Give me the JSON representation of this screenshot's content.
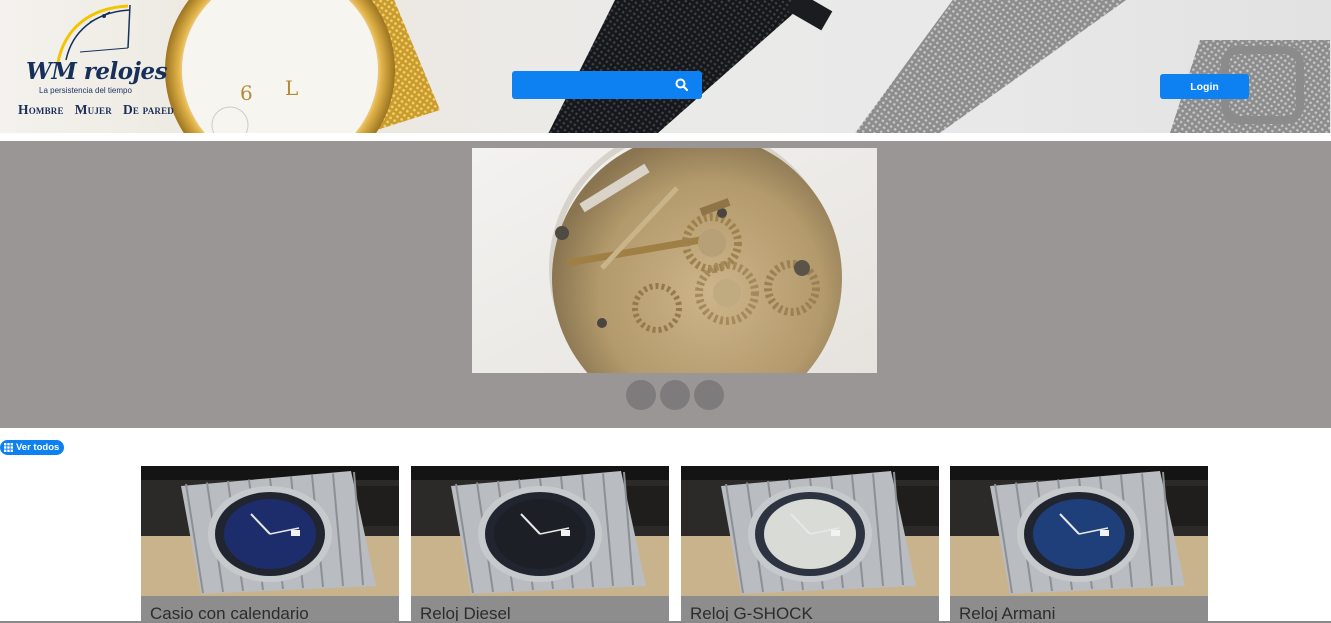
{
  "brand": {
    "name": "WM relojes",
    "tagline": "La persistencia del tiempo"
  },
  "nav": {
    "items": [
      "Hombre",
      "Mujer",
      "De pared"
    ]
  },
  "search": {
    "placeholder": "",
    "icon": "search-icon"
  },
  "header": {
    "login_label": "Login"
  },
  "carousel": {
    "slide_count": 3,
    "active_index": 0,
    "slide_image": "watch-movement-gears"
  },
  "products": {
    "view_all_label": "Ver todos",
    "view_all_icon": "grid-icon",
    "items": [
      {
        "name": "Casio con calendario",
        "dial_color": "#1d2d6b"
      },
      {
        "name": "Reloj Diesel",
        "dial_color": "#1c1f26"
      },
      {
        "name": "Reloj G-SHOCK",
        "dial_color": "#d9dbd7"
      },
      {
        "name": "Reloj Armani",
        "dial_color": "#1f3f7a"
      }
    ]
  },
  "colors": {
    "accent": "#0d80f2",
    "brand_text": "#16305a",
    "carousel_bg": "#9a9696"
  }
}
